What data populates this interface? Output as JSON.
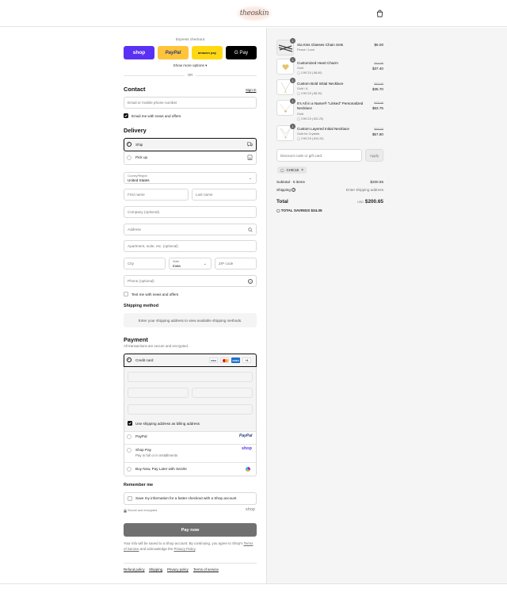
{
  "header": {
    "logo_text": "theoskin",
    "cart_icon": "shopping-bag-icon"
  },
  "express": {
    "label": "Express checkout",
    "buttons": [
      {
        "label": "shop",
        "color": "#5a31f4"
      },
      {
        "label": "PayPal",
        "color": "#ffc439"
      },
      {
        "label": "amazon pay",
        "color": "#ffd814"
      },
      {
        "label": "G Pay",
        "color": "#000000"
      }
    ],
    "more_options": "Show more options",
    "or": "OR"
  },
  "contact": {
    "title": "Contact",
    "sign_in": "Sign in",
    "email_placeholder": "Email or mobile phone number",
    "news_label": "Email me with news and offers"
  },
  "delivery": {
    "title": "Delivery",
    "ship": "Ship",
    "pickup": "Pick up",
    "country_label": "Country/Region",
    "country_value": "United States",
    "first_name": "First name",
    "last_name": "Last name",
    "company": "Company (optional)",
    "address": "Address",
    "apartment": "Apartment, suite, etc. (optional)",
    "city": "City",
    "state_label": "State",
    "state_value": "Iowa",
    "zip": "ZIP code",
    "phone": "Phone (optional)",
    "text_label": "Text me with news and offers"
  },
  "shipping_method": {
    "title": "Shipping method",
    "notice": "Enter your shipping address to view available shipping methods."
  },
  "payment": {
    "title": "Payment",
    "subtitle": "All transactions are secure and encrypted.",
    "credit_card": "Credit card",
    "card_badges": [
      "VISA",
      "MC",
      "AMEX",
      "+4"
    ],
    "billing_label": "Use shipping address as billing address",
    "paypal": "PayPal",
    "paypal_logo": "PayPal",
    "shop_pay": "Shop Pay",
    "shop_pay_sub": "Pay in full or in installments",
    "shop_pay_logo": "shop",
    "sezzle": "Buy Now, Pay Later with Sezzle"
  },
  "remember": {
    "title": "Remember me",
    "save_label": "Save my information for a faster checkout with a Shop account",
    "secure": "Secure and encrypted",
    "shop_logo": "shop"
  },
  "pay_now": "Pay now",
  "legal": {
    "text1": "Your info will be saved to a Shop account. By continuing, you agree to Shop's",
    "terms": "Terms of Service",
    "and": "and acknowledge the",
    "privacy": "Privacy Policy",
    "end": "."
  },
  "footer_links": [
    "Refund policy",
    "Shipping",
    "Privacy policy",
    "Terms of service"
  ],
  "cart": {
    "items": [
      {
        "qty": "1",
        "name": "Sia Kiss Glasses Chain Sets",
        "variant": "Peace / Love",
        "discount": "",
        "old_price": "",
        "price": "$6.00"
      },
      {
        "qty": "1",
        "name": "Customized Heart Charm",
        "variant": "Gold",
        "discount": "CHIC15 (-$6.60)",
        "old_price": "$44.00",
        "price": "$37.40"
      },
      {
        "qty": "1",
        "name": "Custom Bold Initial Necklace",
        "variant": "Gold / A",
        "discount": "CHIC15 (-$6.30)",
        "old_price": "$42.00",
        "price": "$35.70"
      },
      {
        "qty": "1",
        "name": "It's All in a Name® \"Linked\" Personalized Necklace",
        "variant": "Gold",
        "discount": "CHIC15 (-$11.25)",
        "old_price": "$75.00",
        "price": "$63.75"
      },
      {
        "qty": "1",
        "name": "Custom Layered Initial Necklace",
        "variant": "Gold for Crystals",
        "discount": "CHIC15 (-$10.20)",
        "old_price": "$68.00",
        "price": "$57.80"
      }
    ],
    "discount_placeholder": "Discount code or gift card",
    "apply": "Apply",
    "code_tag": "CHIC15",
    "subtotal_label": "Subtotal · 5 items",
    "subtotal_value": "$200.65",
    "shipping_label": "Shipping",
    "shipping_value": "Enter shipping address",
    "total_label": "Total",
    "currency": "USD",
    "total_value": "$200.65",
    "savings_label": "TOTAL SAVINGS",
    "savings_value": "$34.35"
  }
}
